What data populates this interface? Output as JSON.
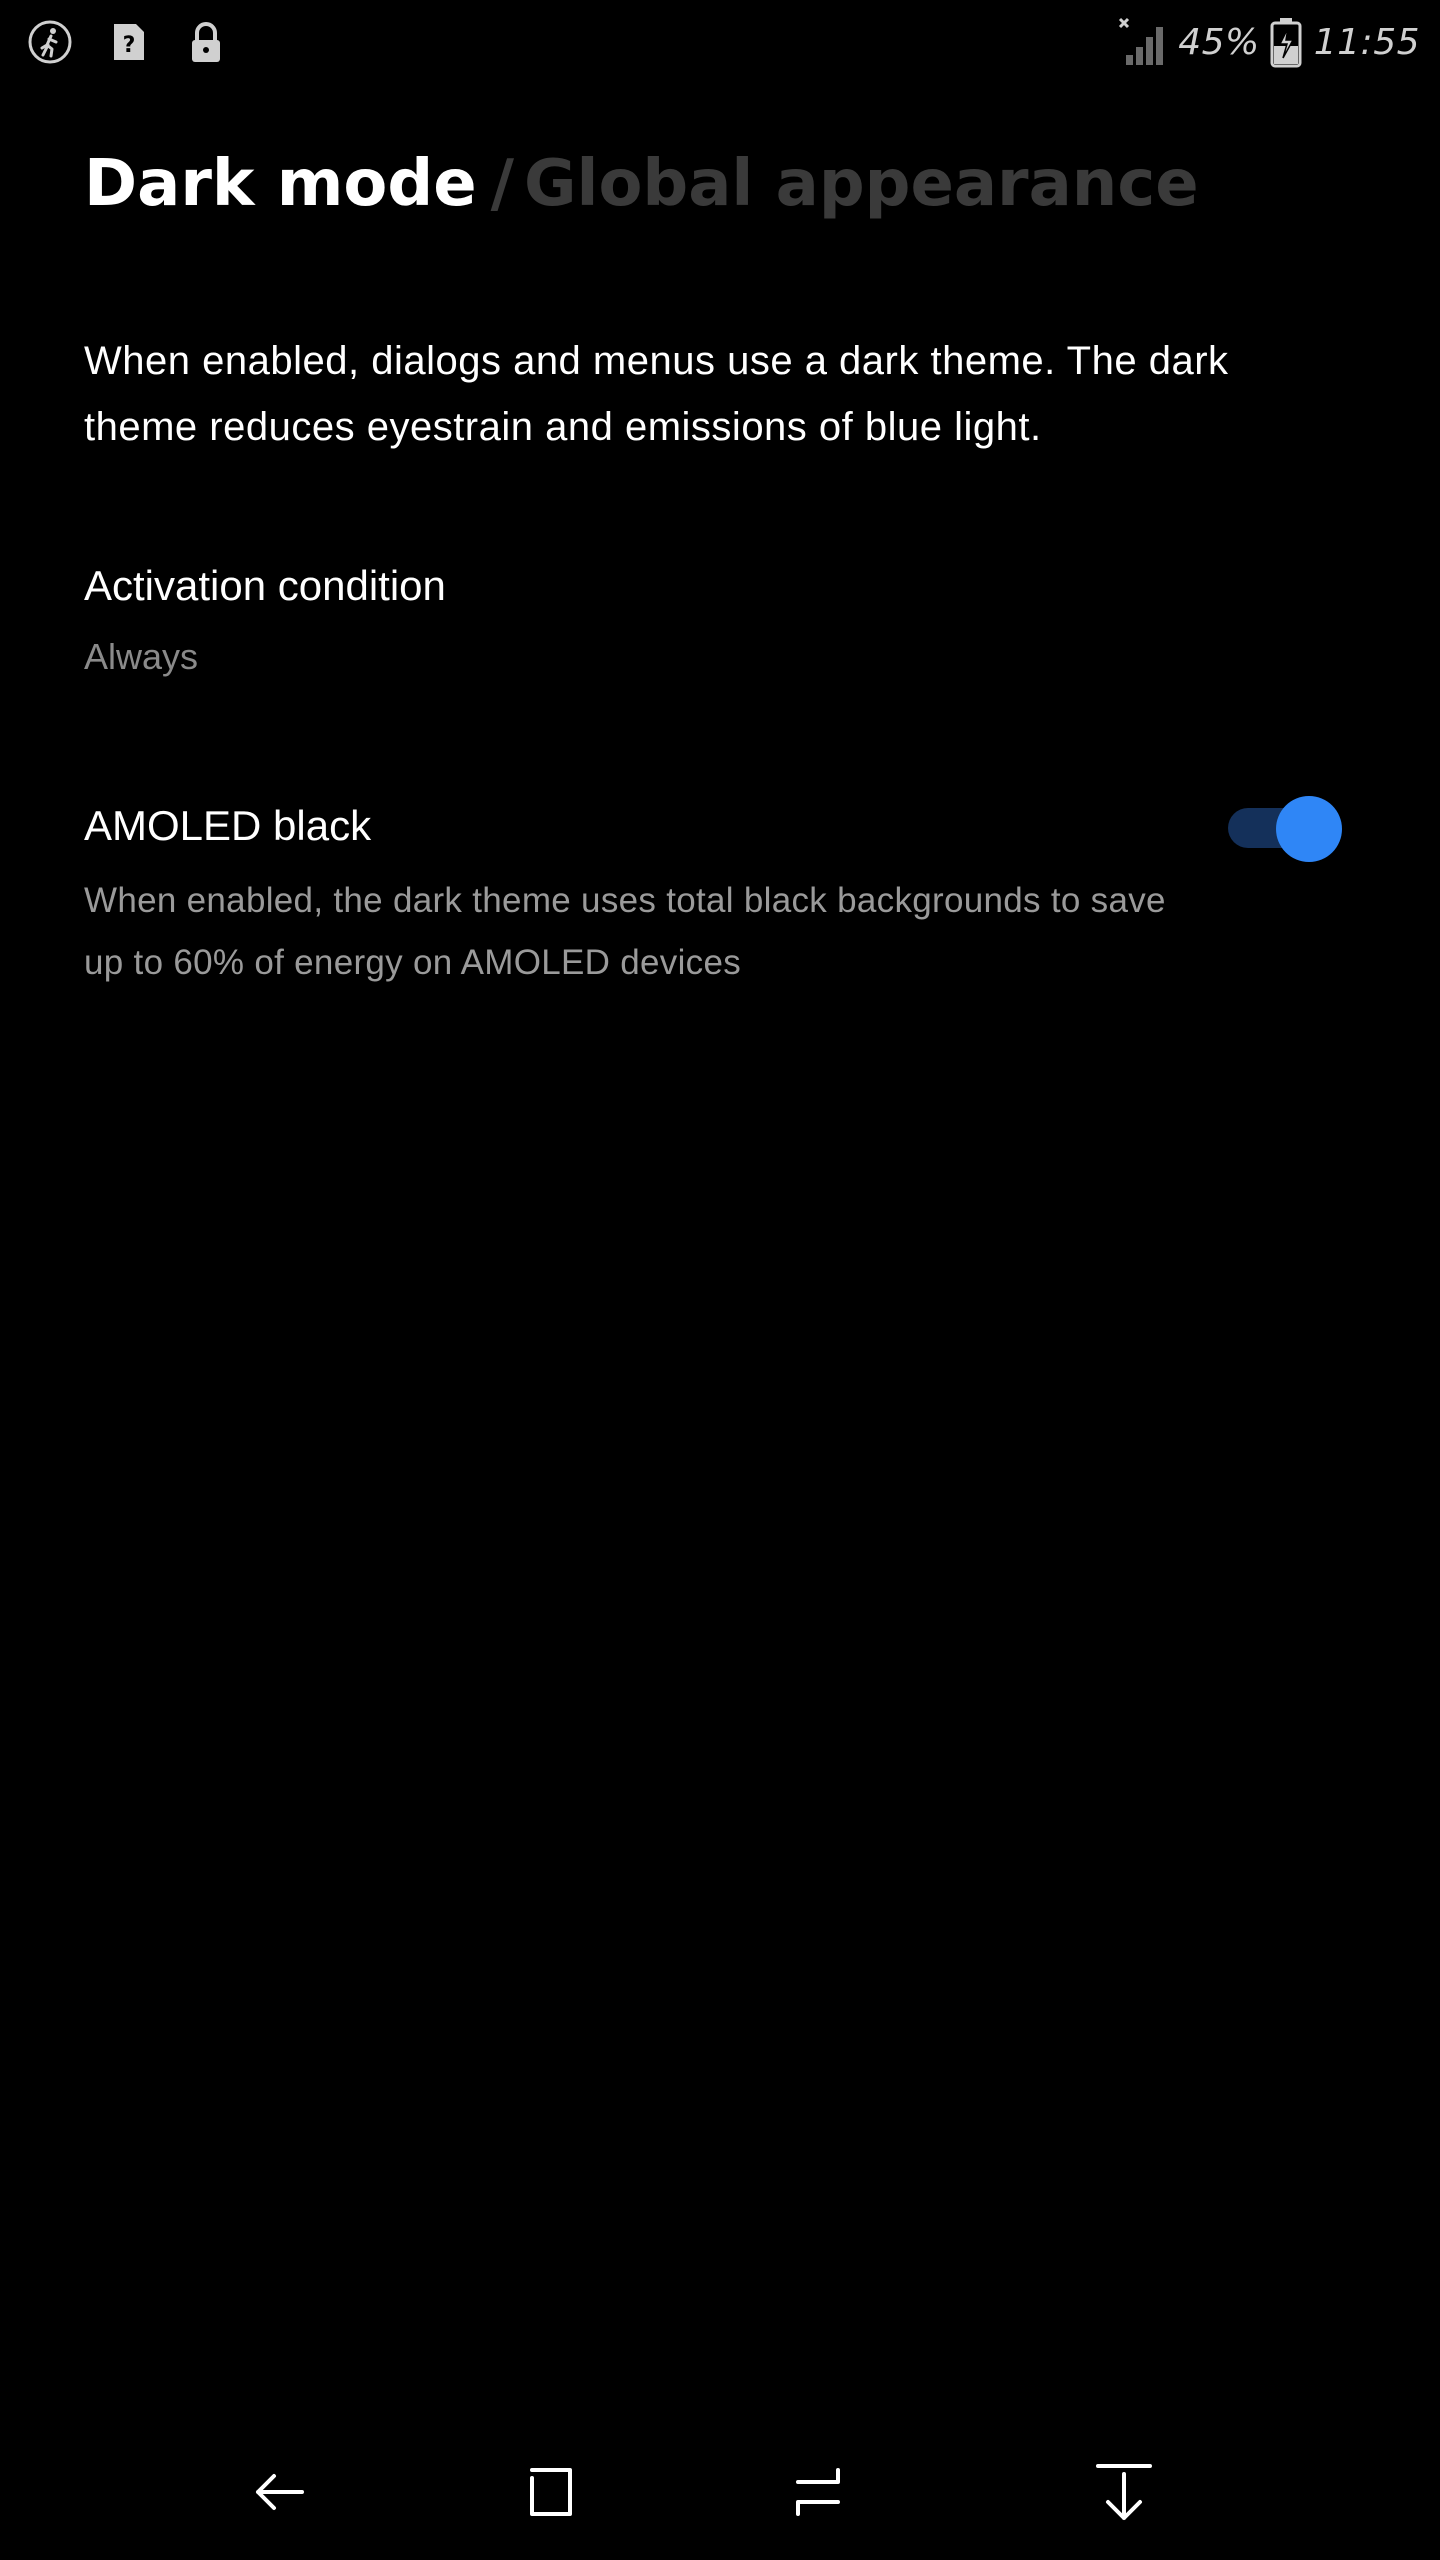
{
  "status_bar": {
    "left_icons": [
      "accessibility-walk-icon",
      "unknown-app-icon",
      "lock-icon"
    ],
    "battery_percent": "45%",
    "time": "11:55",
    "signal_icon": "signal-no-service-icon",
    "battery_icon": "battery-charging-icon",
    "icon_color": "#d0d0d0"
  },
  "header": {
    "current": "Dark mode",
    "separator": "/",
    "parent": "Global appearance"
  },
  "intro_text": "When enabled, dialogs and menus use a dark theme. The dark theme reduces eyestrain and emissions of blue light.",
  "settings": {
    "activation": {
      "title": "Activation condition",
      "value": "Always"
    },
    "amoled": {
      "title": "AMOLED black",
      "description": "When enabled, the dark theme uses total black backgrounds to save up to 60% of energy on AMOLED devices",
      "enabled": true
    }
  },
  "nav_bar": {
    "buttons": [
      "back-arrow-icon",
      "home-square-icon",
      "recents-icon",
      "hide-keyboard-down-icon"
    ]
  },
  "colors": {
    "background": "#000000",
    "accent": "#2f86f6",
    "toggle_track": "#14305a",
    "muted_text": "#8a8a8a",
    "breadcrumb_parent": "#3a3a3a"
  }
}
